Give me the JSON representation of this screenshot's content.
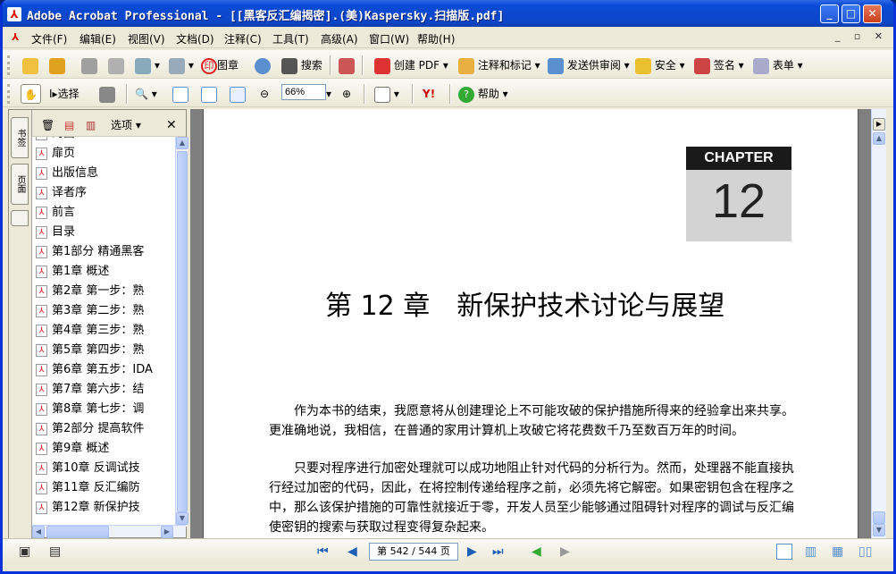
{
  "window": {
    "title": "Adobe Acrobat Professional - [[黑客反汇编揭密].(美)Kaspersky.扫描版.pdf]"
  },
  "menu": [
    "文件(F)",
    "编辑(E)",
    "视图(V)",
    "文档(D)",
    "注释(C)",
    "工具(T)",
    "高级(A)",
    "窗口(W)",
    "帮助(H)"
  ],
  "toolbar1": {
    "stamp_label": "图章",
    "search_label": "搜索",
    "create_pdf": "创建 PDF",
    "comment_markup": "注释和标记",
    "send_review": "发送供审阅",
    "secure": "安全",
    "sign": "签名",
    "forms": "表单"
  },
  "toolbar2": {
    "select_label": "选择",
    "zoom_value": "66%",
    "help_label": "帮助"
  },
  "nav_tabs": [
    "书签",
    "页面"
  ],
  "bookmarks_header": {
    "options_label": "选项"
  },
  "bookmarks": [
    "封面",
    "扉页",
    "出版信息",
    "译者序",
    "前言",
    "目录",
    "第1部分 精通黑客",
    "第1章 概述",
    "第2章 第一步：熟",
    "第3章 第二步：熟",
    "第4章 第三步：熟",
    "第5章 第四步：熟",
    "第6章 第五步：IDA",
    "第7章 第六步：结",
    "第8章 第七步：调",
    "第2部分 提高软件",
    "第9章 概述",
    "第10章 反调试技",
    "第11章 反汇编防",
    "第12章 新保护技"
  ],
  "page": {
    "chapter_label": "CHAPTER",
    "chapter_number": "12",
    "chapter_title": "第 12 章　新保护技术讨论与展望",
    "para1": "作为本书的结束，我愿意将从创建理论上不可能攻破的保护措施所得来的经验拿出来共享。更准确地说，我相信，在普通的家用计算机上攻破它将花费数千乃至数百万年的时间。",
    "para2": "只要对程序进行加密处理就可以成功地阻止针对代码的分析行为。然而，处理器不能直接执行经过加密的代码，因此，在将控制传递给程序之前，必须先将它解密。如果密钥包含在程序之中，那么该保护措施的可靠性就接近于零，开发人员至少能够通过阻碍针对程序的调试与反汇编使密钥的搜索与获取过程变得复杂起来。"
  },
  "statusbar": {
    "page_indicator": "第 542 / 544 页"
  }
}
